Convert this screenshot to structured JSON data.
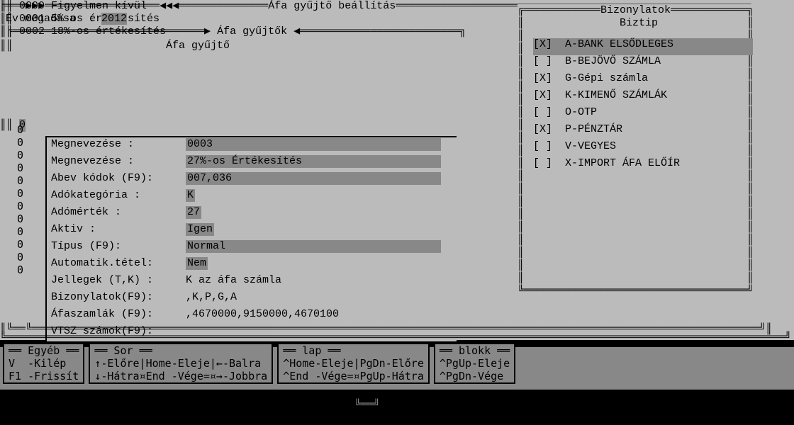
{
  "title": "Áfa gyűjtő beállítás",
  "year": {
    "label": "Év megadása  : ",
    "value": "2012"
  },
  "list": {
    "header_arrow_left": "▶",
    "header_arrow_right": "◀",
    "header_title": "Áfa gyűjtők",
    "subtitle": "Áfa gyűjtő",
    "items": [
      {
        "code": "0000",
        "name": "Figyelmen kívül"
      },
      {
        "code": "0001",
        "name": "5%-os értékesítés"
      },
      {
        "code": "0002",
        "name": "18%-os értékesítés"
      }
    ],
    "sel_prefix": "0",
    "zeros_count": 12
  },
  "detail": {
    "rows": [
      {
        "label": "Megnevezése     ",
        "sep": ":",
        "value": "0003",
        "style": "inv"
      },
      {
        "label": "Megnevezése     ",
        "sep": ":",
        "value": "27%-os Értékesítés",
        "style": "inv"
      },
      {
        "label": "Abev kódok (F9)",
        "sep": ":",
        "value": "007,036",
        "style": "inv"
      },
      {
        "label": "Adókategória    ",
        "sep": ":",
        "value": "K",
        "style": "invs"
      },
      {
        "label": "Adómérték       ",
        "sep": ":",
        "value": "27",
        "style": "invs"
      },
      {
        "label": "Aktiv           ",
        "sep": ":",
        "value": "Igen",
        "style": "invs"
      },
      {
        "label": "Típus      (F9)",
        "sep": ":",
        "value": "Normal",
        "style": "inv"
      },
      {
        "label": "Automatik.tétel",
        "sep": ":",
        "value": "Nem",
        "style": "invs"
      },
      {
        "label": "Jellegek (T,K) ",
        "sep": ":",
        "value": "K az áfa számla",
        "style": "plain"
      },
      {
        "label": "Bizonylatok(F9)",
        "sep": ":",
        "value": ",K,P,G,A",
        "style": "plain"
      },
      {
        "label": "Áfaszamlák (F9)",
        "sep": ":",
        "value": ",4670000,9150000,4670100",
        "style": "plain"
      },
      {
        "label": "VTSZ számok(F9)",
        "sep": ":",
        "value": "",
        "style": "plain"
      }
    ]
  },
  "biz": {
    "title": "Bizonylatok",
    "subtitle": "Biztip",
    "items": [
      {
        "checked": true,
        "label": "A-BANK ELSŐDLEGES",
        "selected": true
      },
      {
        "checked": false,
        "label": "B-BEJÖVŐ SZÁMLA"
      },
      {
        "checked": true,
        "label": "G-Gépi számla"
      },
      {
        "checked": true,
        "label": "K-KIMENŐ SZÁMLÁK"
      },
      {
        "checked": false,
        "label": "O-OTP"
      },
      {
        "checked": true,
        "label": "P-PÉNZTÁR"
      },
      {
        "checked": false,
        "label": "V-VEGYES"
      },
      {
        "checked": false,
        "label": "X-IMPORT ÁFA ELŐÍR"
      }
    ]
  },
  "help": {
    "boxes": [
      {
        "title": "Egyéb",
        "lines": [
          "V  -Kilép",
          "F1 -Frissít"
        ]
      },
      {
        "title": "Sor",
        "lines": [
          "↑-Előre|Home-Eleje|←-Balra",
          "↓-Hátra¤End -Vége=¤→-Jobbra"
        ]
      },
      {
        "title": "lap",
        "lines": [
          "^Home-Eleje|PgDn-Előre",
          "^End -Vége=¤PgUp-Hátra"
        ]
      },
      {
        "title": "blokk",
        "lines": [
          "^PgUp-Eleje",
          "^PgDn-Vége"
        ]
      }
    ]
  }
}
